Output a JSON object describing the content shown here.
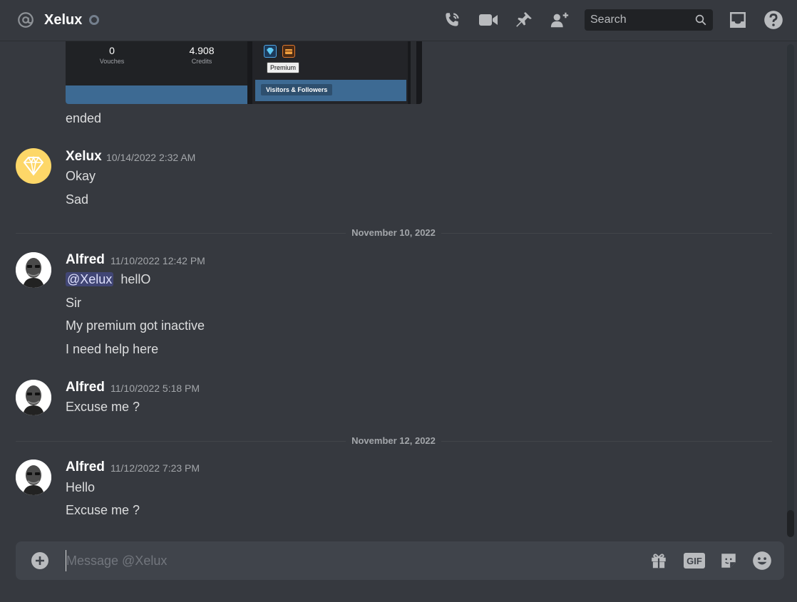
{
  "header": {
    "title": "Xelux",
    "search_placeholder": "Search",
    "icons": [
      "at-icon",
      "status-dot",
      "voice-call-icon",
      "video-call-icon",
      "pin-icon",
      "add-friend-icon",
      "search-icon",
      "inbox-icon",
      "help-icon"
    ]
  },
  "embed": {
    "stats": [
      {
        "value": "0",
        "label": "Vouches"
      },
      {
        "value": "4.908",
        "label": "Credits"
      }
    ],
    "tooltip": "Premium",
    "section_label": "Visitors & Followers"
  },
  "messages": {
    "orphan_line": "ended",
    "groups": [
      {
        "author": "Xelux",
        "timestamp": "10/14/2022 2:32 AM",
        "lines": [
          "Okay",
          "Sad"
        ]
      },
      {
        "author": "Alfred",
        "timestamp": "11/10/2022 12:42 PM",
        "mention": "@Xelux",
        "first_line_rest": "hellO",
        "lines": [
          "Sir",
          "My premium got inactive",
          "I need help here"
        ]
      },
      {
        "author": "Alfred",
        "timestamp": "11/10/2022 5:18 PM",
        "lines": [
          "Excuse me ?"
        ]
      },
      {
        "author": "Alfred",
        "timestamp": "11/12/2022 7:23 PM",
        "lines": [
          "Hello",
          "Excuse me ?"
        ]
      }
    ],
    "dividers": [
      "November 10, 2022",
      "November 12, 2022"
    ]
  },
  "composer": {
    "placeholder": "Message @Xelux",
    "gif_label": "GIF"
  },
  "colors": {
    "background": "#36393f",
    "mention_bg": "#414675",
    "xelux_avatar": "#fdd768"
  }
}
